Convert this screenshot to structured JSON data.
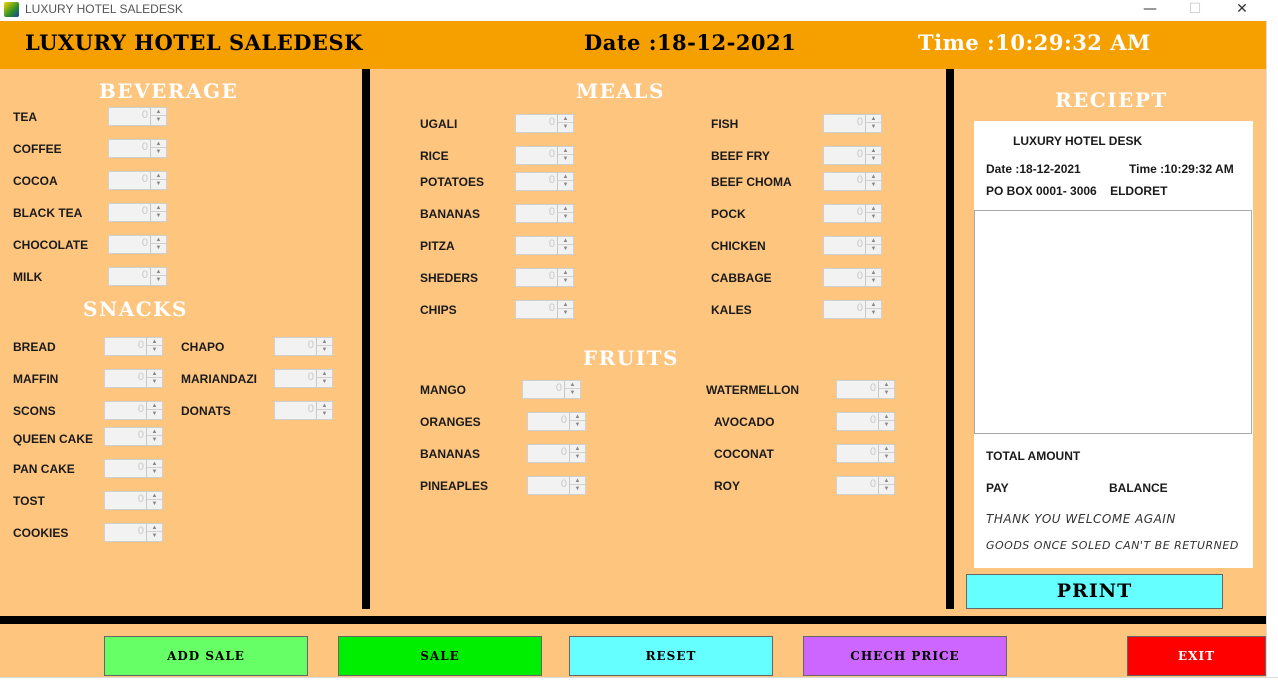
{
  "window": {
    "title": "LUXURY HOTEL SALEDESK",
    "minimize": "—",
    "maximize": "☐",
    "close": "✕"
  },
  "header": {
    "title": "LUXURY HOTEL SALEDESK",
    "date": "Date :18-12-2021",
    "time": "Time :10:29:32 AM"
  },
  "beverage": {
    "title": "BEVERAGE",
    "items": [
      {
        "label": "TEA",
        "value": "0"
      },
      {
        "label": "COFFEE",
        "value": "0"
      },
      {
        "label": "COCOA",
        "value": "0"
      },
      {
        "label": "BLACK TEA",
        "value": "0"
      },
      {
        "label": "CHOCOLATE",
        "value": "0"
      },
      {
        "label": "MILK",
        "value": "0"
      }
    ]
  },
  "snacks": {
    "title": "SNACKS",
    "left": [
      {
        "label": "BREAD",
        "value": "0"
      },
      {
        "label": "MAFFIN",
        "value": "0"
      },
      {
        "label": "SCONS",
        "value": "0"
      },
      {
        "label": "QUEEN CAKE",
        "value": "0"
      },
      {
        "label": "PAN CAKE",
        "value": "0"
      },
      {
        "label": "TOST",
        "value": "0"
      },
      {
        "label": "COOKIES",
        "value": "0"
      }
    ],
    "right": [
      {
        "label": "CHAPO",
        "value": "0"
      },
      {
        "label": "MARIANDAZI",
        "value": "0"
      },
      {
        "label": "DONATS",
        "value": "0"
      }
    ]
  },
  "meals": {
    "title": "MEALS",
    "left": [
      {
        "label": "UGALI",
        "value": "0"
      },
      {
        "label": "RICE",
        "value": "0"
      },
      {
        "label": "POTATOES",
        "value": "0"
      },
      {
        "label": "BANANAS",
        "value": "0"
      },
      {
        "label": "PITZA",
        "value": "0"
      },
      {
        "label": "SHEDERS",
        "value": "0"
      },
      {
        "label": "CHIPS",
        "value": "0"
      }
    ],
    "right": [
      {
        "label": "FISH",
        "value": "0"
      },
      {
        "label": "BEEF FRY",
        "value": "0"
      },
      {
        "label": "BEEF CHOMA",
        "value": "0"
      },
      {
        "label": "POCK",
        "value": "0"
      },
      {
        "label": "CHICKEN",
        "value": "0"
      },
      {
        "label": "CABBAGE",
        "value": "0"
      },
      {
        "label": "KALES",
        "value": "0"
      }
    ]
  },
  "fruits": {
    "title": "FRUITS",
    "left": [
      {
        "label": "MANGO",
        "value": "0"
      },
      {
        "label": "ORANGES",
        "value": "0"
      },
      {
        "label": "BANANAS",
        "value": "0"
      },
      {
        "label": "PINEAPLES",
        "value": "0"
      }
    ],
    "right": [
      {
        "label": "WATERMELLON",
        "value": "0"
      },
      {
        "label": "AVOCADO",
        "value": "0"
      },
      {
        "label": "COCONAT",
        "value": "0"
      },
      {
        "label": "ROY",
        "value": "0"
      }
    ]
  },
  "receipt": {
    "title": "RECIEPT",
    "desk": "LUXURY HOTEL DESK",
    "date": "Date :18-12-2021",
    "time": "Time :10:29:32 AM",
    "address": "PO BOX 0001- 3006    ELDORET",
    "total_label": "TOTAL AMOUNT",
    "pay_label": "PAY",
    "balance_label": "BALANCE",
    "thanks": "THANK YOU WELCOME AGAIN",
    "notice": "GOODS ONCE SOLED CAN'T BE RETURNED"
  },
  "buttons": {
    "print": "PRINT",
    "add_sale": "ADD SALE",
    "sale": "SALE",
    "reset": "RESET",
    "check_price": "CHECH PRICE",
    "exit": "EXIT"
  },
  "colors": {
    "header": "#f6a000",
    "panel": "#fec57f",
    "print": "#66ffff",
    "add_sale": "#66ff66",
    "sale": "#00ee00",
    "reset": "#66ffff",
    "check_price": "#cc66ff",
    "exit": "#ff0000"
  }
}
